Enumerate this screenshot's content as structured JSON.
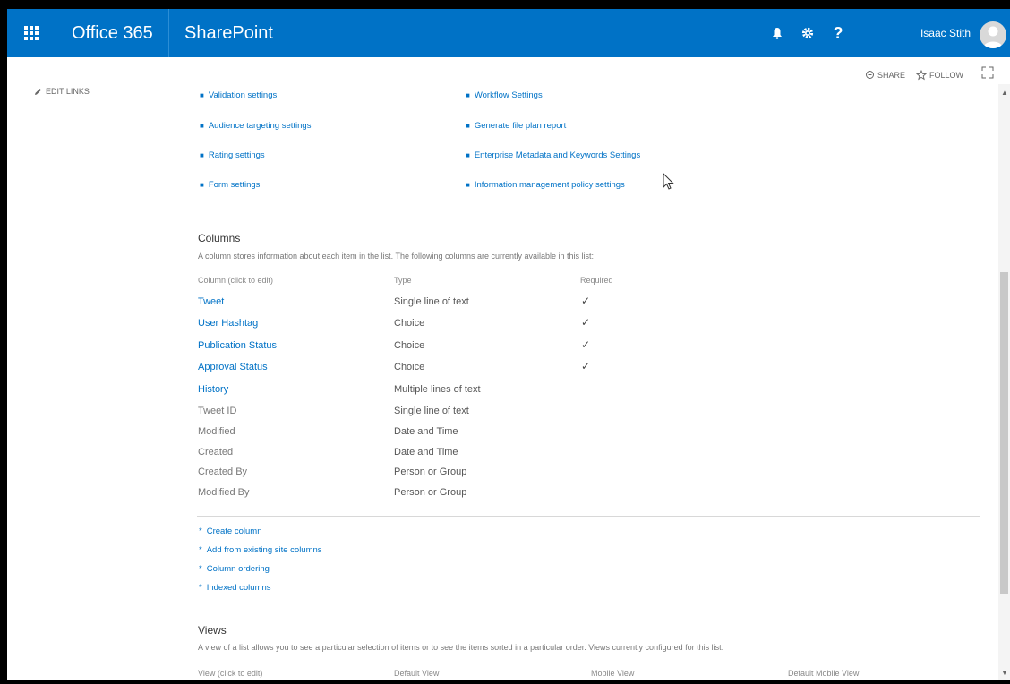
{
  "suitebar": {
    "brand": "Office 365",
    "app": "SharePoint",
    "user_name": "Isaac Stith",
    "icons": [
      "bell-icon",
      "gear-icon",
      "help-icon"
    ],
    "help_label": "?"
  },
  "subbar": {
    "share_label": "SHARE",
    "follow_label": "FOLLOW"
  },
  "left_nav": {
    "edit_links_label": "EDIT LINKS"
  },
  "settings_links": {
    "left": [
      "Validation settings",
      "Audience targeting settings",
      "Rating settings",
      "Form settings"
    ],
    "right": [
      "Workflow Settings",
      "Generate file plan report",
      "Enterprise Metadata and Keywords Settings",
      "Information management policy settings"
    ]
  },
  "columns": {
    "title": "Columns",
    "description": "A column stores information about each item in the list. The following columns are currently available in this list:",
    "headers": {
      "name": "Column (click to edit)",
      "type": "Type",
      "required": "Required"
    },
    "rows": [
      {
        "name": "Tweet",
        "type": "Single line of text",
        "required": true,
        "link": true
      },
      {
        "name": "User Hashtag",
        "type": "Choice",
        "required": true,
        "link": true
      },
      {
        "name": "Publication Status",
        "type": "Choice",
        "required": true,
        "link": true
      },
      {
        "name": "Approval Status",
        "type": "Choice",
        "required": true,
        "link": true
      },
      {
        "name": "History",
        "type": "Multiple lines of text",
        "required": false,
        "link": true
      },
      {
        "name": "Tweet ID",
        "type": "Single line of text",
        "required": false,
        "link": false
      },
      {
        "name": "Modified",
        "type": "Date and Time",
        "required": false,
        "link": false
      },
      {
        "name": "Created",
        "type": "Date and Time",
        "required": false,
        "link": false
      },
      {
        "name": "Created By",
        "type": "Person or Group",
        "required": false,
        "link": false
      },
      {
        "name": "Modified By",
        "type": "Person or Group",
        "required": false,
        "link": false
      }
    ],
    "actions": [
      "Create column",
      "Add from existing site columns",
      "Column ordering",
      "Indexed columns"
    ]
  },
  "views": {
    "title": "Views",
    "description": "A view of a list allows you to see a particular selection of items or to see the items sorted in a particular order. Views currently configured for this list:",
    "headers": {
      "name": "View (click to edit)",
      "default": "Default View",
      "mobile": "Mobile View",
      "default_mobile": "Default Mobile View"
    }
  },
  "colors": {
    "suitebar": "#0072c6",
    "link": "#0072c6"
  }
}
